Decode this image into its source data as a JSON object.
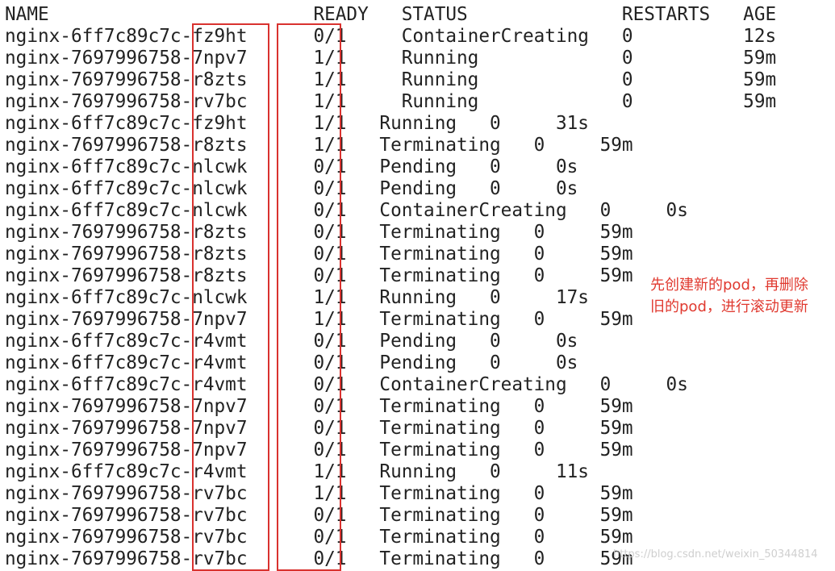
{
  "header": "NAME                        READY   STATUS              RESTARTS   AGE",
  "lines": [
    "nginx-6ff7c89c7c-fz9ht      0/1     ContainerCreating   0          12s",
    "nginx-7697996758-7npv7      1/1     Running             0          59m",
    "nginx-7697996758-r8zts      1/1     Running             0          59m",
    "nginx-7697996758-rv7bc      1/1     Running             0          59m",
    "nginx-6ff7c89c7c-fz9ht      1/1   Running   0     31s",
    "nginx-7697996758-r8zts      1/1   Terminating   0     59m",
    "nginx-6ff7c89c7c-nlcwk      0/1   Pending   0     0s",
    "nginx-6ff7c89c7c-nlcwk      0/1   Pending   0     0s",
    "nginx-6ff7c89c7c-nlcwk      0/1   ContainerCreating   0     0s",
    "nginx-7697996758-r8zts      0/1   Terminating   0     59m",
    "nginx-7697996758-r8zts      0/1   Terminating   0     59m",
    "nginx-7697996758-r8zts      0/1   Terminating   0     59m",
    "nginx-6ff7c89c7c-nlcwk      1/1   Running   0     17s",
    "nginx-7697996758-7npv7      1/1   Terminating   0     59m",
    "nginx-6ff7c89c7c-r4vmt      0/1   Pending   0     0s",
    "nginx-6ff7c89c7c-r4vmt      0/1   Pending   0     0s",
    "nginx-6ff7c89c7c-r4vmt      0/1   ContainerCreating   0     0s",
    "nginx-7697996758-7npv7      0/1   Terminating   0     59m",
    "nginx-7697996758-7npv7      0/1   Terminating   0     59m",
    "nginx-7697996758-7npv7      0/1   Terminating   0     59m",
    "nginx-6ff7c89c7c-r4vmt      1/1   Running   0     11s",
    "nginx-7697996758-rv7bc      1/1   Terminating   0     59m",
    "nginx-7697996758-rv7bc      0/1   Terminating   0     59m",
    "nginx-7697996758-rv7bc      0/1   Terminating   0     59m",
    "nginx-7697996758-rv7bc      0/1   Terminating   0     59m"
  ],
  "annotation": "先创建新的pod，再删除旧的pod，进行滚动更新",
  "watermark": "https://blog.csdn.net/weixin_50344814",
  "colors": {
    "highlight_box": "#d9322f",
    "annotation_text": "#e0392f",
    "terminal_text": "#222222"
  }
}
